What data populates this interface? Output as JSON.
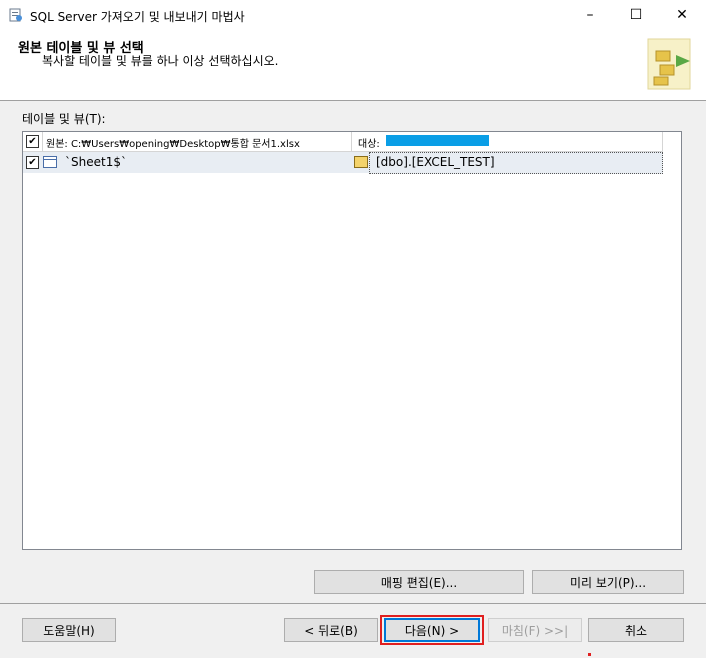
{
  "window": {
    "title": "SQL Server 가져오기 및 내보내기 마법사",
    "minimize": "–",
    "maximize": "☐",
    "close": "✕"
  },
  "header": {
    "title": "원본 테이블 및 뷰 선택",
    "subtitle": "복사할 테이블 및 뷰를 하나 이상 선택하십시오."
  },
  "list": {
    "label": "테이블 및 뷰(T):",
    "columns": {
      "source": "원본: C:₩Users₩opening₩Desktop₩통합 문서1.xlsx",
      "destination": "대상:"
    },
    "rows": [
      {
        "checked": "✔",
        "source": "`Sheet1$`",
        "destination": "[dbo].[EXCEL_TEST]"
      }
    ],
    "header_checked": "✔"
  },
  "buttons": {
    "edit_mappings": "매핑 편집(E)...",
    "preview": "미리 보기(P)...",
    "help": "도움말(H)",
    "back": "< 뒤로(B)",
    "next": "다음(N) >",
    "finish": "마침(F) >>|",
    "cancel": "취소"
  },
  "colors": {
    "destination_highlight": "#0a9ee6",
    "focus_outline": "#e02020"
  }
}
